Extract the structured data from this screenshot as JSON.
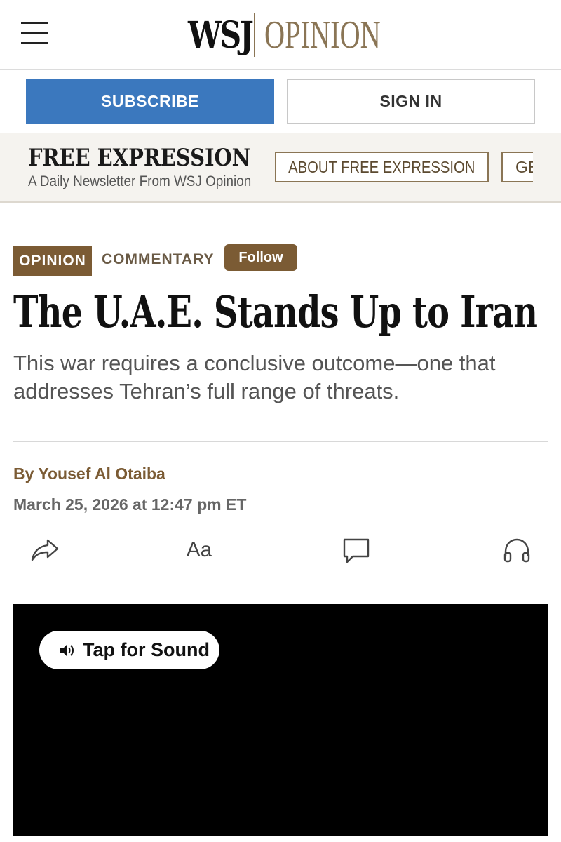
{
  "header": {
    "logo_left": "WSJ",
    "logo_right": "OPINION",
    "menu_icon": "hamburger-menu-icon"
  },
  "auth": {
    "subscribe_label": "SUBSCRIBE",
    "signin_label": "SIGN IN"
  },
  "newsletter": {
    "title": "FREE EXPRESSION",
    "subtitle": "A Daily Newsletter From WSJ Opinion",
    "about_label": "ABOUT FREE EXPRESSION",
    "more_label": "GE"
  },
  "article": {
    "section_tag": "OPINION",
    "category": "COMMENTARY",
    "follow_label": "Follow",
    "headline": "The U.A.E. Stands Up to Iran",
    "dek": "This war requires a conclusive outcome—one that addresses Tehran’s full range of threats.",
    "byline": "By Yousef Al Otaiba",
    "date": "March 25, 2026 at 12:47 pm ET"
  },
  "actions": {
    "text_size_label": "Aa",
    "icons": [
      "share-icon",
      "text-size-icon",
      "comment-icon",
      "headphones-icon"
    ]
  },
  "video": {
    "tap_for_sound_label": "Tap for Sound",
    "sound_icon": "speaker-icon"
  },
  "colors": {
    "brand_blue": "#3b78be",
    "opinion_brown": "#7b5b34",
    "logo_gold": "#8a7555"
  }
}
